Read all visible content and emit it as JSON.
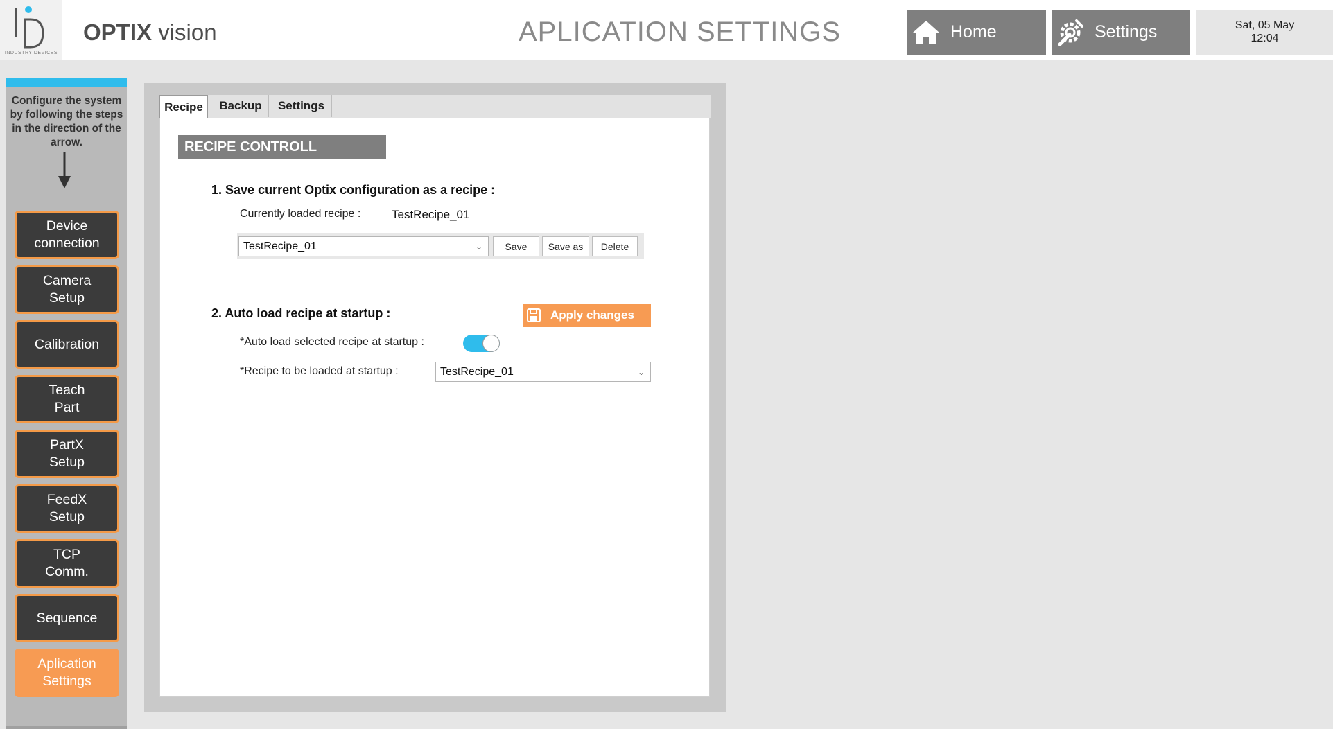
{
  "logo": {
    "company_text": "INDUSTRY DEVICES"
  },
  "header": {
    "app_name_bold": "OPTIX",
    "app_name_rest": " vision",
    "page_title": "APLICATION SETTINGS",
    "nav": {
      "home": "Home",
      "settings": "Settings"
    },
    "date": "Sat, 05 May",
    "time": "12:04"
  },
  "sidebar": {
    "hint": "Configure the system by following the steps in the direction of the arrow.",
    "items": [
      {
        "label": "Device\nconnection"
      },
      {
        "label": "Camera\nSetup"
      },
      {
        "label": "Calibration"
      },
      {
        "label": "Teach\nPart"
      },
      {
        "label": "PartX\nSetup"
      },
      {
        "label": "FeedX\nSetup"
      },
      {
        "label": "TCP\nComm."
      },
      {
        "label": "Sequence"
      },
      {
        "label": "Aplication\nSettings"
      }
    ]
  },
  "tabs": {
    "recipe": "Recipe",
    "backup": "Backup",
    "settings": "Settings"
  },
  "recipe": {
    "section_title": "RECIPE CONTROLL",
    "step1_title": "1. Save current Optix configuration as a recipe :",
    "loaded_label": "Currently loaded recipe :",
    "loaded_value": "TestRecipe_01",
    "select_value": "TestRecipe_01",
    "save": "Save",
    "save_as": "Save as",
    "delete": "Delete",
    "step2_title": "2. Auto load recipe at startup :",
    "apply": "Apply changes",
    "autoload_label": "*Auto load selected recipe at startup :",
    "autoload_enabled": true,
    "startup_label": "*Recipe to be loaded at startup :",
    "startup_value": "TestRecipe_01"
  },
  "colors": {
    "accent_orange": "#f79b53",
    "accent_blue": "#2fbcec",
    "nav_gray": "#7f7f7f"
  }
}
